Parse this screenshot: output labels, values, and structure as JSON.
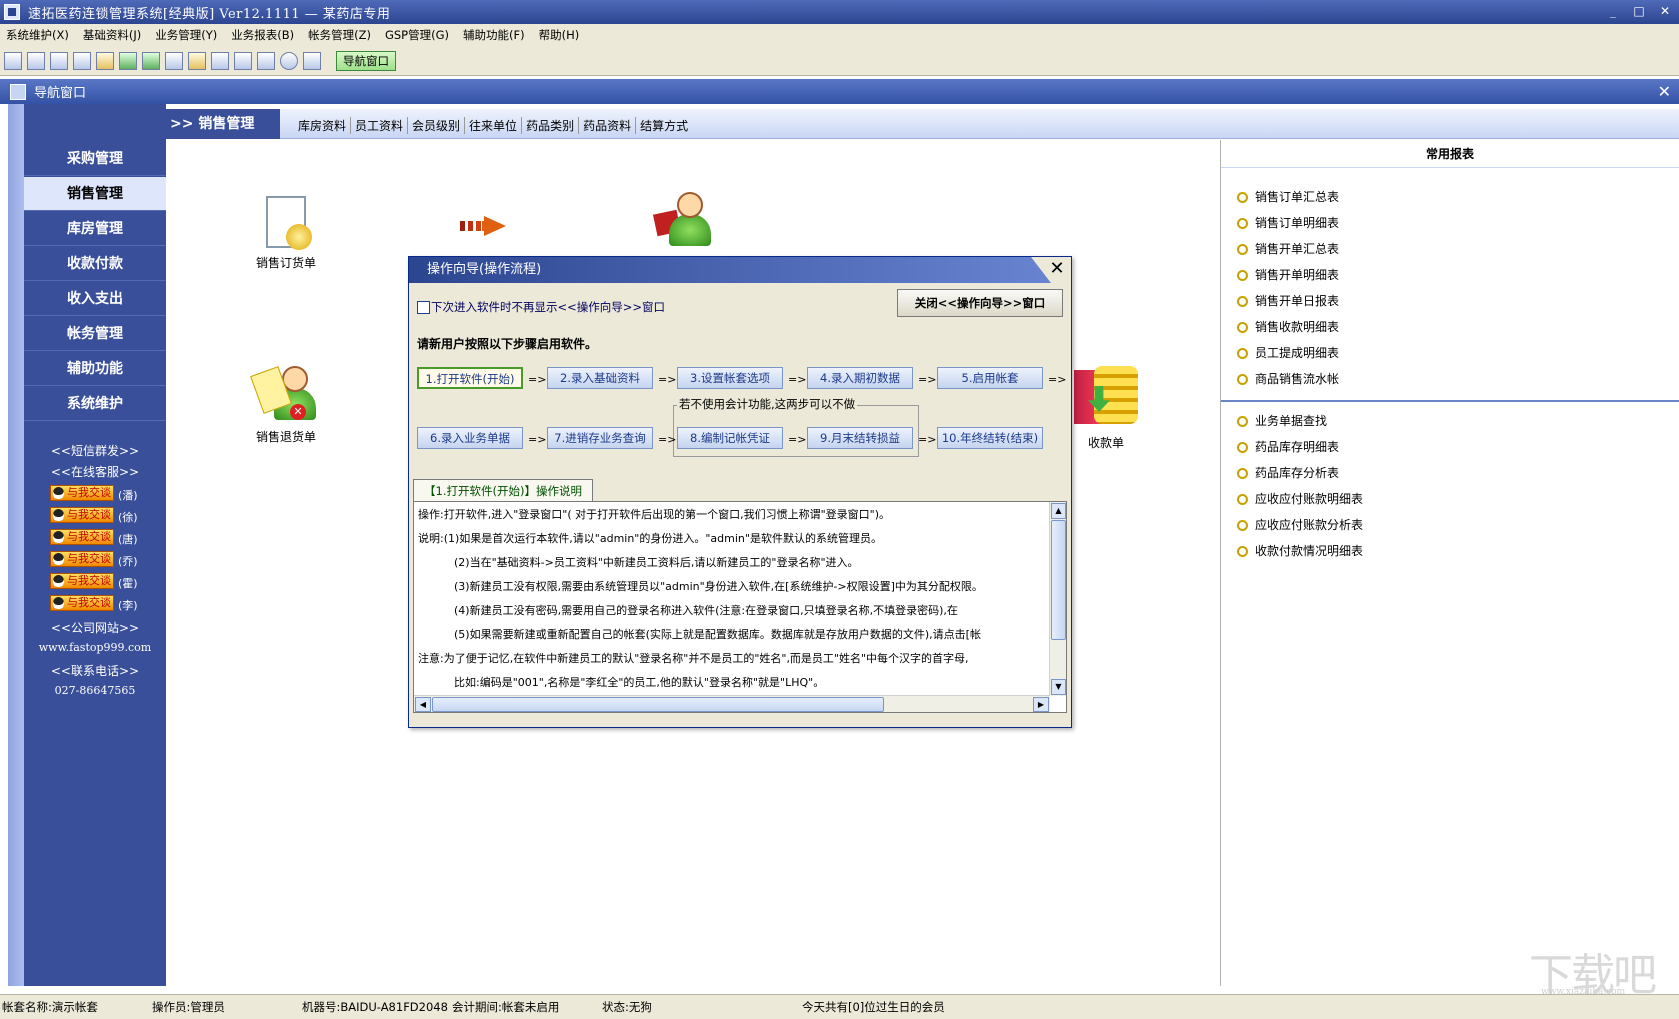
{
  "app": {
    "title": "速拓医药连锁管理系统[经典版] Ver12.1111 — 某药店专用",
    "window_controls": [
      "_",
      "□",
      "✕"
    ]
  },
  "menu": [
    "系统维护(X)",
    "基础资料(J)",
    "业务管理(Y)",
    "业务报表(B)",
    "帐务管理(Z)",
    "GSP管理(G)",
    "辅助功能(F)",
    "帮助(H)"
  ],
  "toolbar": {
    "nav_button": "导航窗口"
  },
  "nav_window": {
    "title": "导航窗口",
    "close": "✕"
  },
  "sidebar": {
    "items": [
      {
        "label": "采购管理"
      },
      {
        "label": "销售管理",
        "active": true
      },
      {
        "label": "库房管理"
      },
      {
        "label": "收款付款"
      },
      {
        "label": "收入支出"
      },
      {
        "label": "帐务管理"
      },
      {
        "label": "辅助功能"
      },
      {
        "label": "系统维护"
      }
    ],
    "sms": "<<短信群发>>",
    "online": "<<在线客服>>",
    "qq_label": "与我交谈",
    "qq_names": [
      "(潘)",
      "(徐)",
      "(唐)",
      "(乔)",
      "(霍)",
      "(李)"
    ],
    "site_label": "<<公司网站>>",
    "site": "www.fastop999.com",
    "phone_label": "<<联系电话>>",
    "phone": "027-86647565"
  },
  "content": {
    "title": ">> 销售管理",
    "links": [
      "库房资料",
      "员工资料",
      "会员级别",
      "往来单位",
      "药品类别",
      "药品资料",
      "结算方式"
    ],
    "flow": {
      "order": "销售订货单",
      "return": "销售退货单",
      "receipt": "收款单"
    }
  },
  "reports": {
    "title": "常用报表",
    "group1": [
      "销售订单汇总表",
      "销售订单明细表",
      "销售开单汇总表",
      "销售开单明细表",
      "销售开单日报表",
      "销售收款明细表",
      "员工提成明细表",
      "商品销售流水帐"
    ],
    "group2": [
      "业务单据查找",
      "药品库存明细表",
      "药品库存分析表",
      "应收应付账款明细表",
      "应收应付账款分析表",
      "收款付款情况明细表"
    ]
  },
  "dialog": {
    "title": "操作向导(操作流程)",
    "checkbox_label": "下次进入软件时不再显示<<操作向导>>窗口",
    "close_button": "关闭<<操作向导>>窗口",
    "intro": "请新用户按照以下步骤启用软件。",
    "steps": [
      "1.打开软件(开始)",
      "2.录入基础资料",
      "3.设置帐套选项",
      "4.录入期初数据",
      "5.启用帐套",
      "6.录入业务单据",
      "7.进销存业务查询",
      "8.编制记帐凭证",
      "9.月末结转损益",
      "10.年终结转(结束)"
    ],
    "arrow": "=>",
    "optional_note": "若不使用会计功能,这两步可以不做",
    "tab": "【1.打开软件(开始)】操作说明",
    "text_lines": [
      "操作:打开软件,进入\"登录窗口\"( 对于打开软件后出现的第一个窗口,我们习惯上称谓\"登录窗口\")。",
      "说明:(1)如果是首次运行本软件,请以\"admin\"的身份进入。\"admin\"是软件默认的系统管理员。",
      "(2)当在\"基础资料->员工资料\"中新建员工资料后,请以新建员工的\"登录名称\"进入。",
      "(3)新建员工没有权限,需要由系统管理员以\"admin\"身份进入软件,在[系统维护->权限设置]中为其分配权限。",
      "(4)新建员工没有密码,需要用自己的登录名称进入软件(注意:在登录窗口,只填登录名称,不填登录密码),在",
      "(5)如果需要新建或重新配置自己的帐套(实际上就是配置数据库。数据库就是存放用户数据的文件),请点击[帐",
      "注意:为了便于记忆,在软件中新建员工的默认\"登录名称\"并不是员工的\"姓名\",而是员工\"姓名\"中每个汉字的首字母,",
      "比如:编码是\"001\",名称是\"李红全\"的员工,他的默认\"登录名称\"就是\"LHQ\"。"
    ]
  },
  "status": {
    "account": "帐套名称:演示帐套",
    "operator": "操作员:管理员",
    "machine": "机器号:BAIDU-A81FD2048",
    "period": "会计期间:帐套未启用",
    "state": "状态:无狗",
    "birthday": "今天共有[0]位过生日的会员"
  },
  "watermark": {
    "big": "下载吧",
    "small": "www.xiazaiba.com"
  }
}
